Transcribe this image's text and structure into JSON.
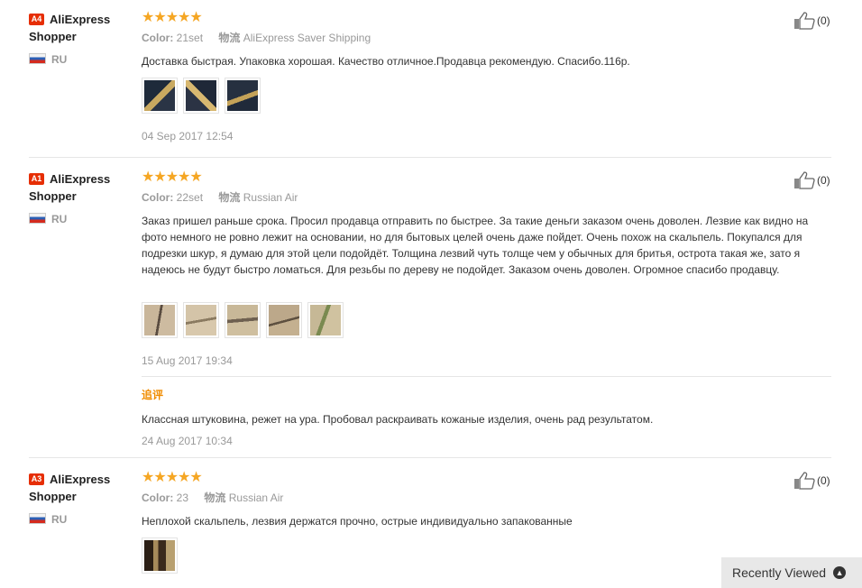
{
  "like_icon": "thumbs-up-icon",
  "accent_color": "#f5a623",
  "reviews": [
    {
      "level": "A4",
      "user": "AliExpress Shopper",
      "country": "RU",
      "stars": "★★★★★",
      "color_key": "Color:",
      "color_val": "21set",
      "ship_key": "物流",
      "ship_val": "AliExpress Saver Shipping",
      "text": "Доставка быстрая. Упаковка хорошая. Качество отличное.Продавца рекомендую. Спасибо.116р.",
      "date": "04 Sep 2017 12:54",
      "likes": "(0)"
    },
    {
      "level": "A1",
      "user": "AliExpress Shopper",
      "country": "RU",
      "stars": "★★★★★",
      "color_key": "Color:",
      "color_val": "22set",
      "ship_key": "物流",
      "ship_val": "Russian Air",
      "text": "Заказ пришел раньше срока. Просил продавца отправить по быстрее. За такие деньги заказом очень доволен. Лезвие как видно на фото немного не ровно лежит на основании, но для бытовых целей очень даже пойдет. Очень похож на скальпель. Покупался для подрезки шкур, я думаю для этой цели подойдёт. Толщина лезвий чуть толще чем у обычных для бритья, острота такая же, зато я надеюсь не будут быстро ломаться. Для резьбы по дереву не подойдет. Заказом очень доволен. Огромное спасибо продавцу.",
      "date": "15 Aug 2017 19:34",
      "likes": "(0)",
      "followup_label": "追评",
      "followup_text": "Классная штуковина, режет на ура. Пробовал раскраивать кожаные изделия, очень рад результатом.",
      "followup_date": "24 Aug 2017 10:34"
    },
    {
      "level": "A3",
      "user": "AliExpress Shopper",
      "country": "RU",
      "stars": "★★★★★",
      "color_key": "Color:",
      "color_val": "23",
      "ship_key": "物流",
      "ship_val": "Russian Air",
      "text": "Неплохой скальпель, лезвия держатся прочно, острые индивидуально запакованные",
      "likes": "(0)"
    }
  ],
  "recently_viewed": "Recently Viewed"
}
